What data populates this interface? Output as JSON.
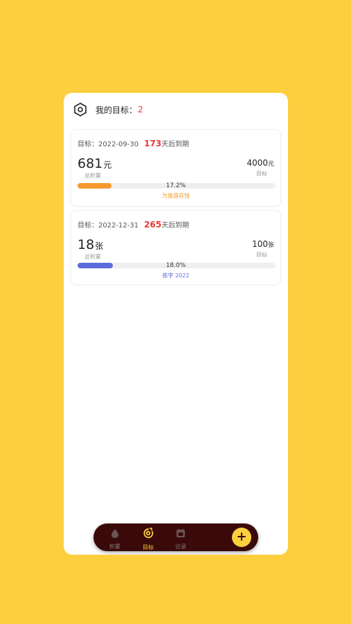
{
  "header": {
    "title": "我的目标：",
    "count": "2"
  },
  "goals": [
    {
      "target_date_label": "目标：",
      "target_date": "2022-09-30",
      "days_left": "173",
      "days_suffix": "天后到期",
      "saved_amount": "681",
      "saved_unit": "元",
      "saved_label": "总积累",
      "target_amount": "4000",
      "target_unit": "元",
      "target_label": "目标",
      "progress_text": "17.2%",
      "progress": 0.172,
      "name": "为旅游存钱",
      "color": "#F59A2E"
    },
    {
      "target_date_label": "目标：",
      "target_date": "2022-12-31",
      "days_left": "265",
      "days_suffix": "天后到期",
      "saved_amount": "18",
      "saved_unit": "张",
      "saved_label": "总积累",
      "target_amount": "100",
      "target_unit": "张",
      "target_label": "目标",
      "progress_text": "18.0%",
      "progress": 0.18,
      "name": "练字 2022",
      "color": "#5B6BDB"
    }
  ],
  "tabbar": {
    "tabs": [
      {
        "label": "积累",
        "icon": "drop-icon",
        "active": false
      },
      {
        "label": "目标",
        "icon": "target-icon",
        "active": true
      },
      {
        "label": "记录",
        "icon": "calendar-icon",
        "active": false
      }
    ],
    "add_icon": "plus-icon"
  },
  "colors": {
    "background": "#FDCF3F",
    "accent": "#FDCF3F",
    "tabbar": "#3A0A0A",
    "highlight": "#E53935"
  }
}
